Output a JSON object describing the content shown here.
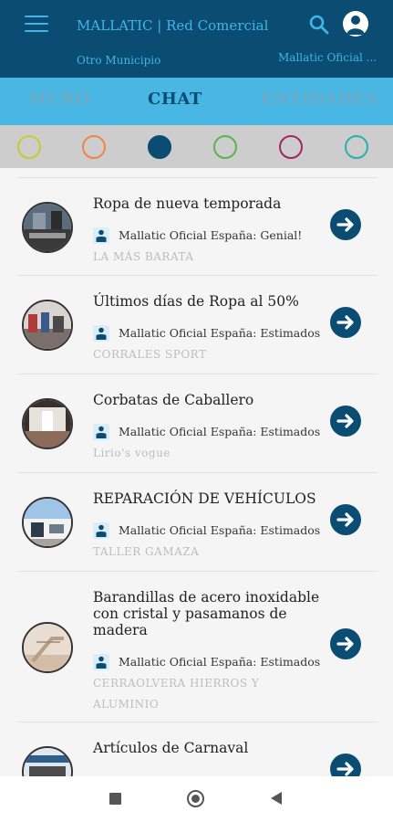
{
  "header": {
    "title": "MALLATIC | Red Comercial",
    "municipality": "Otro Municipio",
    "account": "Mallatic Oficial ...",
    "menu_icon": "menu-icon",
    "search_icon": "search-icon",
    "profile_icon": "user-icon"
  },
  "tabs": [
    {
      "label": "MURO",
      "active": false
    },
    {
      "label": "CHAT",
      "active": true
    },
    {
      "label": "ENTIDADES",
      "active": false
    }
  ],
  "filters": [
    {
      "color": "#c3cc31",
      "filled": false
    },
    {
      "color": "#ee8548",
      "filled": false
    },
    {
      "color": "#0b4c73",
      "filled": true
    },
    {
      "color": "#5cb44a",
      "filled": false
    },
    {
      "color": "#a2285a",
      "filled": false
    },
    {
      "color": "#2aafb0",
      "filled": false
    }
  ],
  "chats": [
    {
      "title": "Ropa de nueva temporada",
      "message": "Mallatic Oficial España: Genial!",
      "entity": "LA MÁS BARATA"
    },
    {
      "title": "Últimos días de Ropa al 50%",
      "message": "Mallatic Oficial España: Estimados",
      "entity": "CORRALES SPORT"
    },
    {
      "title": "Corbatas de Caballero",
      "message": "Mallatic Oficial España: Estimados",
      "entity": "Lirio's vogue"
    },
    {
      "title": "REPARACIÓN DE VEHÍCULOS",
      "message": "Mallatic Oficial España: Estimados",
      "entity": "TALLER GAMAZA"
    },
    {
      "title": "Barandillas de acero inoxidable con cristal y pasamanos de madera",
      "message": "Mallatic Oficial España: Estimados",
      "entity": "CERRAOLVERA HIERROS Y ALUMINIO"
    },
    {
      "title": "Artículos de Carnaval",
      "message": "",
      "entity": ""
    }
  ],
  "colors": {
    "header_bg": "#0b4c73",
    "accent": "#3fb6e6",
    "tab_bg": "#48b7e3"
  }
}
